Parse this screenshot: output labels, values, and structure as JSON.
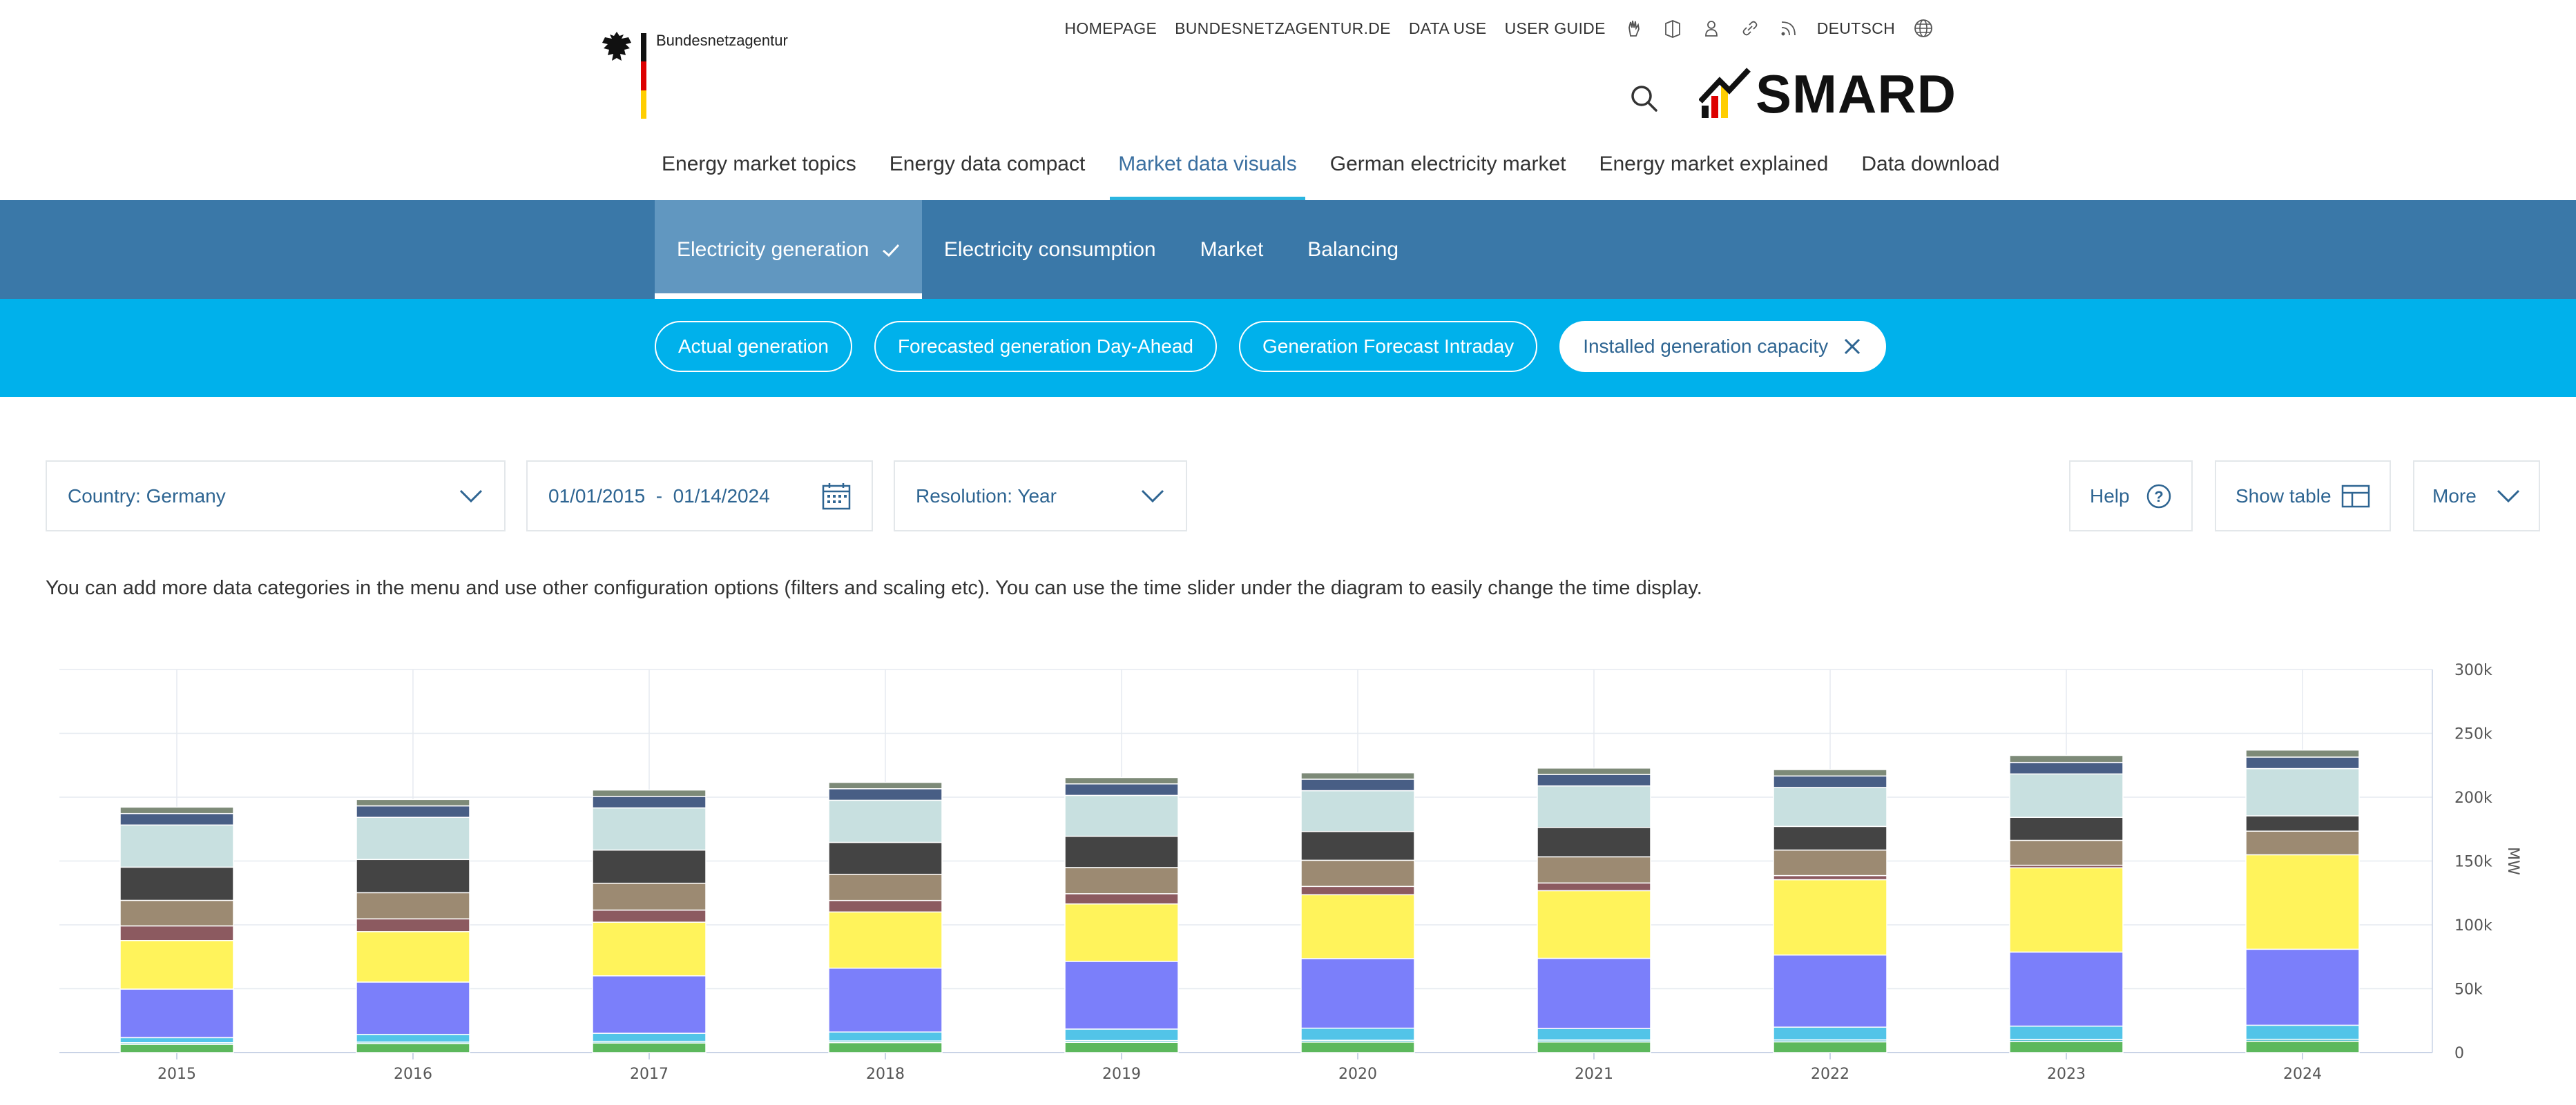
{
  "header": {
    "org_name": "Bundesnetzagentur",
    "top_links": [
      "HOMEPAGE",
      "BUNDESNETZAGENTUR.DE",
      "DATA USE",
      "USER GUIDE"
    ],
    "language": "DEUTSCH",
    "brand": "SMARD",
    "main_nav": [
      "Energy market topics",
      "Energy data compact",
      "Market data visuals",
      "German electricity market",
      "Energy market explained",
      "Data download"
    ],
    "main_nav_active": "Market data visuals"
  },
  "subnav": {
    "tabs": [
      "Electricity generation",
      "Electricity consumption",
      "Market",
      "Balancing"
    ],
    "active": "Electricity generation"
  },
  "pills": {
    "items": [
      "Actual generation",
      "Forecasted generation Day-Ahead",
      "Generation Forecast Intraday",
      "Installed generation capacity"
    ],
    "selected": "Installed generation capacity"
  },
  "controls": {
    "country": "Country: Germany",
    "date_from": "01/01/2015",
    "date_sep": "-",
    "date_to": "01/14/2024",
    "resolution": "Resolution: Year",
    "help": "Help",
    "show_table": "Show table",
    "more": "More"
  },
  "info_text": "You can add more data categories in the menu and use other configuration options (filters and scaling etc). You can use the time slider under the diagram to easily change the time display.",
  "colors": {
    "header_blue": "#3a78a8",
    "pill_cyan": "#00b1eb",
    "link_blue": "#2e6592"
  },
  "chart_data": {
    "type": "bar",
    "stacked": true,
    "categories": [
      "2015",
      "2016",
      "2017",
      "2018",
      "2019",
      "2020",
      "2021",
      "2022",
      "2023",
      "2024"
    ],
    "ylabel": "MW",
    "ylim": [
      0,
      300000
    ],
    "y_ticks": [
      {
        "value": 0,
        "label": "0"
      },
      {
        "value": 50000,
        "label": "50k"
      },
      {
        "value": 100000,
        "label": "100k"
      },
      {
        "value": 150000,
        "label": "150k"
      },
      {
        "value": 200000,
        "label": "200k"
      },
      {
        "value": 250000,
        "label": "250k"
      },
      {
        "value": 300000,
        "label": "300k"
      }
    ],
    "grid": true,
    "series": [
      {
        "color": "#5cb85c",
        "values": [
          6500,
          7000,
          7500,
          7800,
          8000,
          8200,
          8300,
          8400,
          8600,
          8800
        ]
      },
      {
        "color": "#5bc2cf",
        "values": [
          1200,
          1200,
          1300,
          1300,
          1400,
          1400,
          1500,
          1500,
          1600,
          1600
        ]
      },
      {
        "color": "#52c4e8",
        "values": [
          4000,
          6000,
          6300,
          7000,
          9000,
          9500,
          9000,
          10000,
          10500,
          11000
        ]
      },
      {
        "color": "#7b7ffa",
        "values": [
          38000,
          41000,
          45000,
          50000,
          53000,
          54500,
          55000,
          56500,
          58000,
          59500
        ]
      },
      {
        "color": "#fff35b",
        "values": [
          38000,
          39500,
          42000,
          44000,
          45000,
          50000,
          53000,
          59000,
          66000,
          74000
        ]
      },
      {
        "color": "#8c5a60",
        "values": [
          11500,
          10000,
          9500,
          9000,
          8000,
          6500,
          6000,
          3200,
          2000,
          0
        ]
      },
      {
        "color": "#9c8a72",
        "values": [
          20000,
          20500,
          21000,
          20500,
          20500,
          20500,
          20500,
          20000,
          19500,
          18500
        ]
      },
      {
        "color": "#444444",
        "values": [
          26000,
          26000,
          26000,
          25000,
          24500,
          22500,
          23000,
          18500,
          18000,
          12000
        ]
      },
      {
        "color": "#c8e0e0",
        "values": [
          33000,
          33000,
          33000,
          33000,
          32000,
          32000,
          32500,
          30500,
          34000,
          37000
        ]
      },
      {
        "color": "#485e85",
        "values": [
          9000,
          9000,
          9000,
          9000,
          9000,
          9000,
          9000,
          9000,
          9000,
          9000
        ]
      },
      {
        "color": "#7d8a78",
        "values": [
          5000,
          5000,
          5000,
          5000,
          5000,
          5000,
          5000,
          5000,
          5500,
          5500
        ]
      }
    ]
  }
}
